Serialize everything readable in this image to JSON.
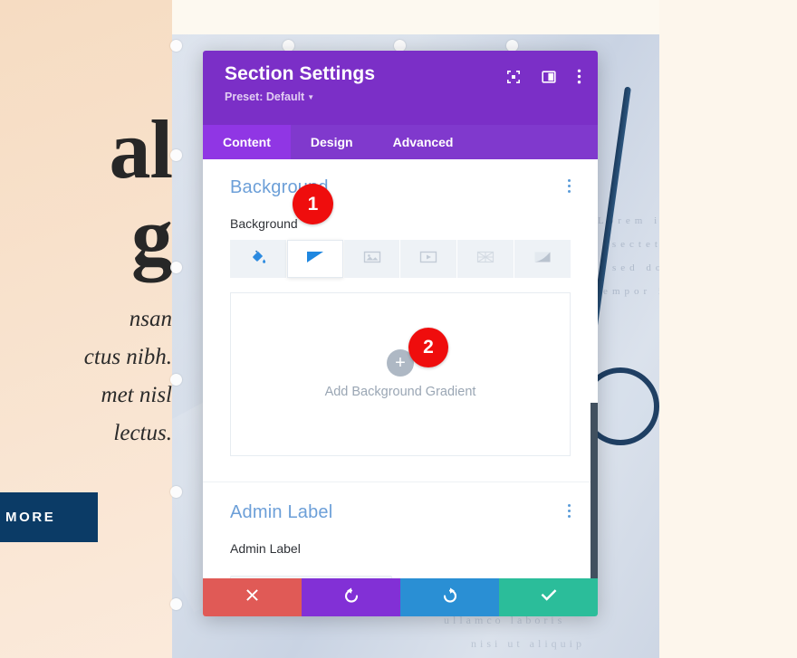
{
  "background_page": {
    "headline_line1": "al",
    "headline_line2": "g",
    "sub_line1": "nsan",
    "sub_line2": "ctus nibh.",
    "sub_line3": "met nisl",
    "sub_line4": "lectus.",
    "cta_label": "LEARN MORE",
    "cta_color": "#0b3b66",
    "page_bg": "#f7e0c9"
  },
  "modal": {
    "title": "Section Settings",
    "preset_label": "Preset: Default",
    "header_color": "#7b2fc7",
    "header_icons": [
      {
        "name": "focus-icon",
        "title": "Focus"
      },
      {
        "name": "layout-panel-icon",
        "title": "Layout"
      },
      {
        "name": "more-vertical-icon",
        "title": "More options"
      }
    ],
    "tabs": [
      {
        "label": "Content",
        "active": true
      },
      {
        "label": "Design",
        "active": false
      },
      {
        "label": "Advanced",
        "active": false
      }
    ],
    "sections": {
      "background": {
        "heading": "Background",
        "field_label": "Background",
        "type_tabs": [
          {
            "name": "background-color-tab",
            "label": "Background Color",
            "active": false
          },
          {
            "name": "background-gradient-tab",
            "label": "Background Gradient",
            "active": true
          },
          {
            "name": "background-image-tab",
            "label": "Background Image",
            "active": false
          },
          {
            "name": "background-video-tab",
            "label": "Background Video",
            "active": false
          },
          {
            "name": "background-pattern-tab",
            "label": "Background Pattern",
            "active": false
          },
          {
            "name": "background-mask-tab",
            "label": "Background Mask",
            "active": false
          }
        ],
        "add_gradient_label": "Add Background Gradient",
        "plus_symbol": "+"
      },
      "admin_label": {
        "heading": "Admin Label",
        "field_label": "Admin Label",
        "input_value": ""
      }
    },
    "footer_buttons": [
      {
        "name": "cancel-button",
        "icon": "close-icon",
        "color": "#e05a56"
      },
      {
        "name": "undo-button",
        "icon": "undo-icon",
        "color": "#8230d6"
      },
      {
        "name": "redo-button",
        "icon": "redo-icon",
        "color": "#2a8fd4"
      },
      {
        "name": "save-button",
        "icon": "check-icon",
        "color": "#2bbd9a"
      }
    ]
  },
  "annotations": [
    {
      "number": "1",
      "color": "#ef0d0d"
    },
    {
      "number": "2",
      "color": "#ef0d0d"
    }
  ]
}
